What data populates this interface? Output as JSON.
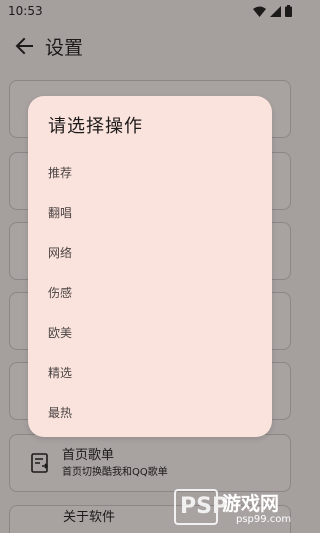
{
  "status_bar": {
    "time": "10:53",
    "icons": [
      "wifi-icon",
      "signal-icon",
      "battery-icon"
    ]
  },
  "app_bar": {
    "back_icon": "arrow-back-icon",
    "title": "设置"
  },
  "background_cards": [
    {
      "icon": "playlist-icon",
      "title": "首页歌单",
      "subtitle": "首页切换酷我和QQ歌单"
    },
    {
      "title": "关于软件"
    }
  ],
  "dialog": {
    "title": "请选择操作",
    "options": [
      "推荐",
      "翻唱",
      "网络",
      "伤感",
      "欧美",
      "精选",
      "最热"
    ]
  },
  "watermark": {
    "logo_text": "PSP",
    "name": "游戏网",
    "url": "psp99.com"
  },
  "colors": {
    "scrim_background": "#a59f9e",
    "dialog_background": "#fbe3dd",
    "card_border": "#8c8685",
    "text_primary": "#1d1a1a",
    "option_text": "#4a4443"
  }
}
